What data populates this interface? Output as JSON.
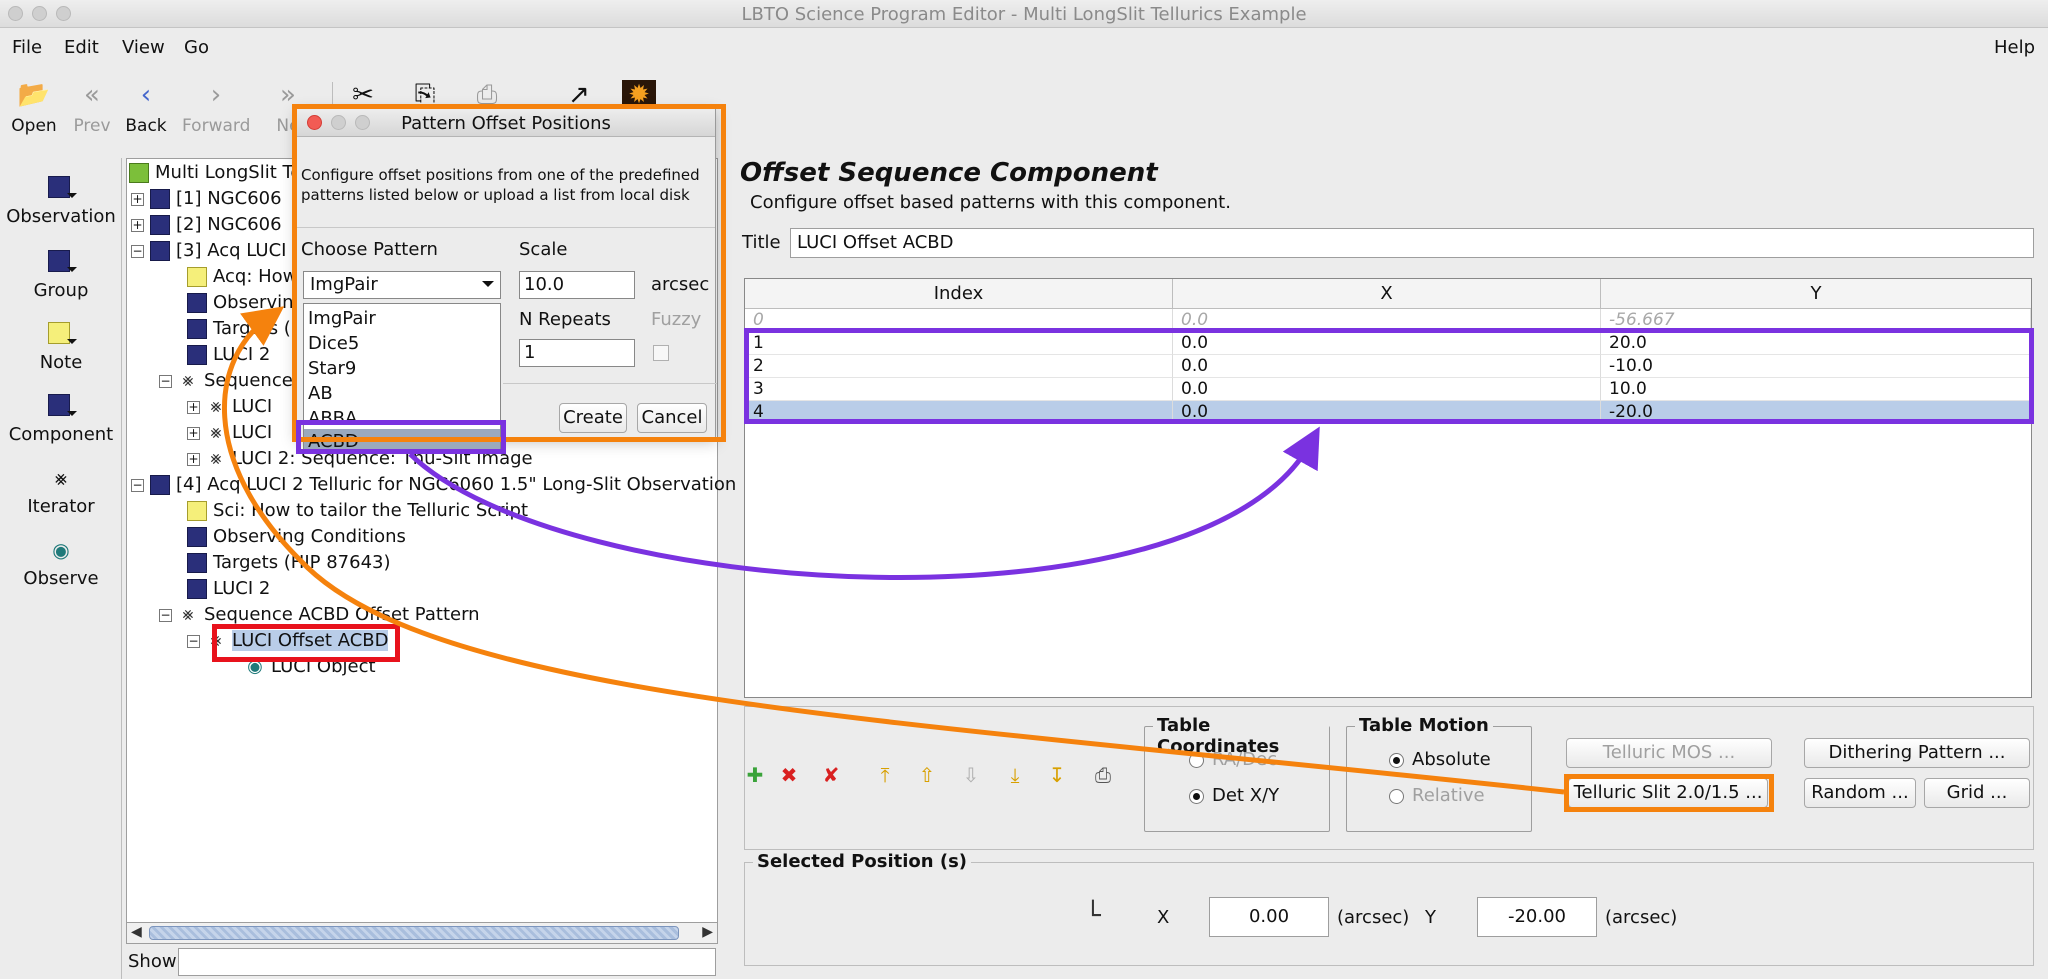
{
  "window": {
    "title": "LBTO Science Program Editor - Multi LongSlit Tellurics Example"
  },
  "menu": {
    "items": [
      "File",
      "Edit",
      "View",
      "Go"
    ],
    "help": "Help"
  },
  "toolbar": {
    "open": "Open",
    "prev": "Prev",
    "back": "Back",
    "forward": "Forward",
    "next": "Ne"
  },
  "palette": {
    "observation": "Observation",
    "group": "Group",
    "note": "Note",
    "component": "Component",
    "iterator": "Iterator",
    "observe": "Observe"
  },
  "tree": {
    "root": "Multi LongSlit Te",
    "n1": "[1] NGC606",
    "n2": "[2] NGC606",
    "n3": "[3] Acq LUCI",
    "n3_acq": "Acq: How",
    "n3_obs": "Observin",
    "n3_targets": "Targets (",
    "n3_luci": "LUCI 2",
    "n3_seq": "Sequence",
    "n3_seq_a": "LUCI",
    "n3_seq_b": "LUCI",
    "n3_seq_c": "LUCI 2: Sequence: Thu-Slit Image",
    "n4": "[4] Acq LUCI 2 Telluric for NGC6060 1.5\" Long-Slit Observation",
    "n4_sci": "Sci: How to tailor the Telluric Script",
    "n4_obs": "Observing Conditions",
    "n4_targets": "Targets (HIP 87643)",
    "n4_luci": "LUCI 2",
    "n4_seq": "Sequence ACBD Offset Pattern",
    "n4_offset": "LUCI Offset ACBD",
    "n4_object": "LUCI Object",
    "show_label": "Show"
  },
  "component": {
    "heading": "Offset Sequence Component",
    "description": "Configure offset based patterns with this component.",
    "title_label": "Title",
    "title_value": "LUCI Offset ACBD"
  },
  "table": {
    "columns": [
      "Index",
      "X",
      "Y"
    ],
    "rows": [
      {
        "index": "0",
        "x": "0.0",
        "y": "-56.667"
      },
      {
        "index": "1",
        "x": "0.0",
        "y": "20.0"
      },
      {
        "index": "2",
        "x": "0.0",
        "y": "-10.0"
      },
      {
        "index": "3",
        "x": "0.0",
        "y": "10.0"
      },
      {
        "index": "4",
        "x": "0.0",
        "y": "-20.0"
      }
    ]
  },
  "controls": {
    "table_coordinates": "Table Coordinates",
    "ra_dec": "RA/Dec",
    "det_xy": "Det X/Y",
    "table_motion": "Table Motion",
    "absolute": "Absolute",
    "relative": "Relative",
    "telluric_mos": "Telluric MOS ...",
    "telluric_slit": "Telluric Slit 2.0/1.5 ...",
    "dithering": "Dithering Pattern ...",
    "random": "Random ...",
    "grid": "Grid ..."
  },
  "selected_position": {
    "legend": "Selected Position (s)",
    "x_label": "X",
    "x_value": "0.00",
    "x_unit": "(arcsec)",
    "y_label": "Y",
    "y_value": "-20.00",
    "y_unit": "(arcsec)"
  },
  "dialog": {
    "title": "Pattern Offset Positions",
    "description": "Configure offset positions from one of the predefined patterns listed below or upload a list from local disk",
    "choose_pattern": "Choose Pattern",
    "selected_pattern": "ImgPair",
    "patterns": [
      "ImgPair",
      "Dice5",
      "Star9",
      "AB",
      "ABBA",
      "ACBD"
    ],
    "scale_label": "Scale",
    "scale_value": "10.0",
    "scale_unit": "arcsec",
    "repeats_label": "N Repeats",
    "repeats_value": "1",
    "fuzzy_label": "Fuzzy",
    "create": "Create",
    "cancel": "Cancel"
  },
  "colors": {
    "orange": "#f5820d",
    "purple": "#7a32e0",
    "red": "#e8121c",
    "selection": "#b9cde8"
  }
}
